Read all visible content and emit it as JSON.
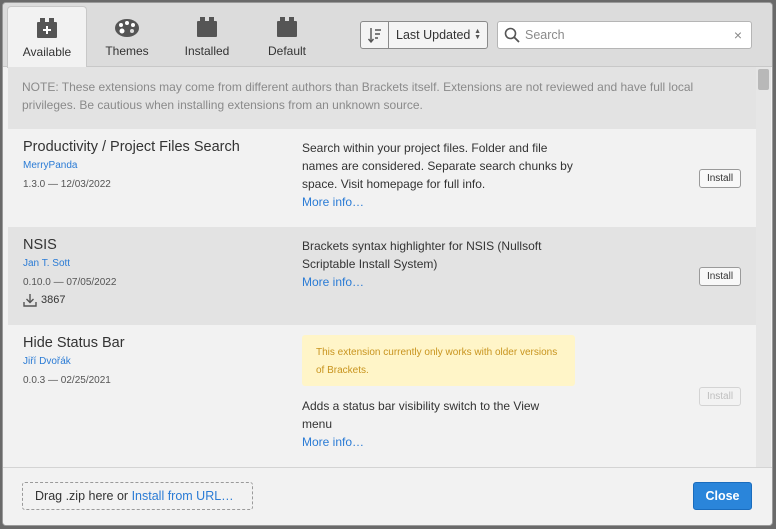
{
  "tabs": [
    {
      "label": "Available",
      "icon": "puzzle-add-icon",
      "active": true
    },
    {
      "label": "Themes",
      "icon": "palette-icon",
      "active": false
    },
    {
      "label": "Installed",
      "icon": "puzzle-icon",
      "active": false
    },
    {
      "label": "Default",
      "icon": "puzzle-icon",
      "active": false
    }
  ],
  "sort": {
    "icon": "sort-icon",
    "selected": "Last Updated"
  },
  "search": {
    "placeholder": "Search",
    "value": "",
    "clear": "×"
  },
  "note": "NOTE: These extensions may come from different authors than Brackets itself. Extensions are not reviewed and have full local privileges. Be cautious when installing extensions from an unknown source.",
  "extensions": [
    {
      "title": "Productivity / Project Files Search",
      "author": "MerryPanda",
      "version": "1.3.0 — 12/03/2022",
      "description": "Search within your project files. Folder and file names are considered. Separate search chunks by space. Visit homepage for full info.",
      "more": "More info…",
      "install": "Install"
    },
    {
      "title": "NSIS",
      "author": "Jan T. Sott",
      "version": "0.10.0 — 07/05/2022",
      "downloads": "3867",
      "description": "Brackets syntax highlighter for NSIS (Nullsoft Scriptable Install System)",
      "more": "More info…",
      "install": "Install"
    },
    {
      "title": "Hide Status Bar",
      "author": "Jiří Dvořák",
      "version": "0.0.3 — 02/25/2021",
      "warning": "This extension currently only works with older versions of Brackets.",
      "description": "Adds a status bar visibility switch to the View menu",
      "more": "More info…",
      "install": "Install"
    }
  ],
  "footer": {
    "drop_text": "Drag .zip here or ",
    "drop_link": "Install from URL…",
    "close": "Close"
  },
  "colors": {
    "accent": "#2a85da",
    "link": "#2a7bd5",
    "warning_bg": "#fff5c8",
    "warning_text": "#c8941e"
  }
}
